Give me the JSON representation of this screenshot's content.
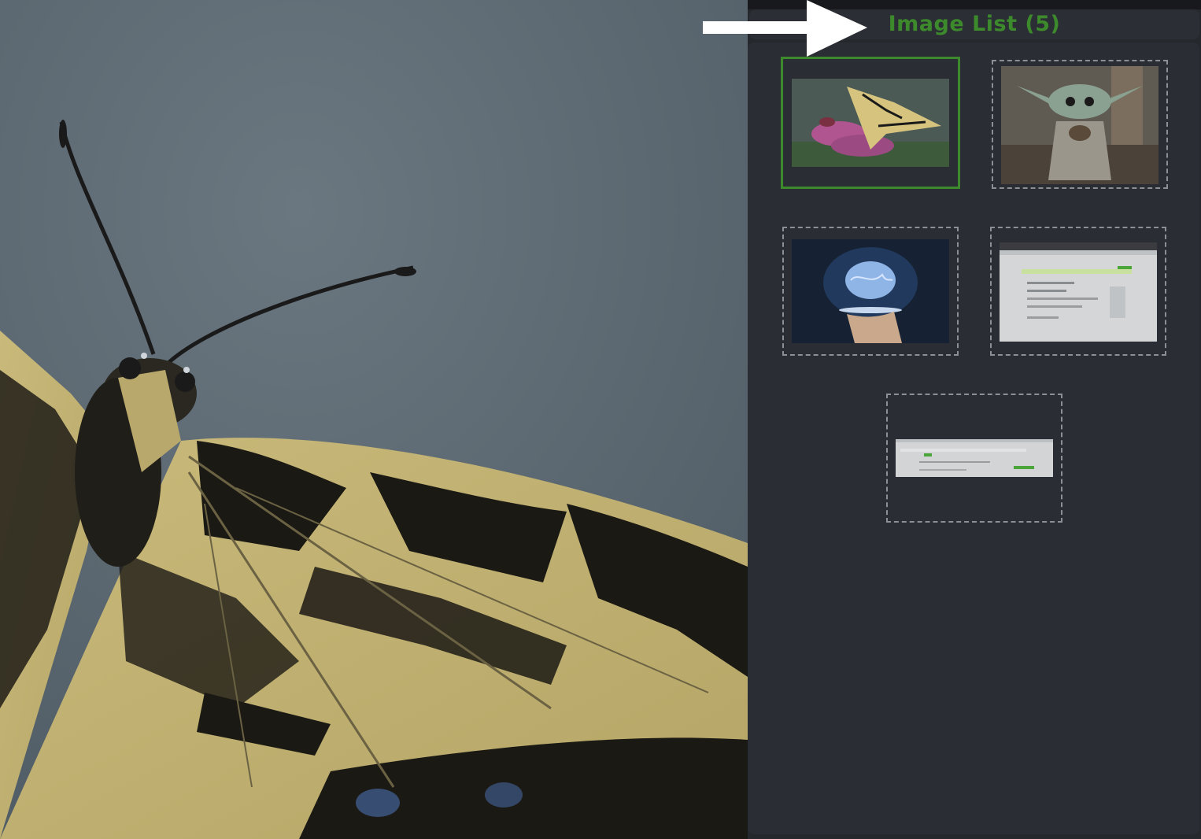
{
  "panel": {
    "title": "Image List (5)"
  },
  "thumbnails": [
    {
      "subject": "butterfly",
      "selected": true
    },
    {
      "subject": "baby-yoda",
      "selected": false
    },
    {
      "subject": "brain-hologram",
      "selected": false
    },
    {
      "subject": "webpage-screenshot",
      "selected": false
    },
    {
      "subject": "webpage-screenshot-wide",
      "selected": false
    }
  ],
  "colors": {
    "accent": "#3c8a2c",
    "panel_bg": "#2a2d33",
    "viewer_bg": "#5b6872"
  }
}
